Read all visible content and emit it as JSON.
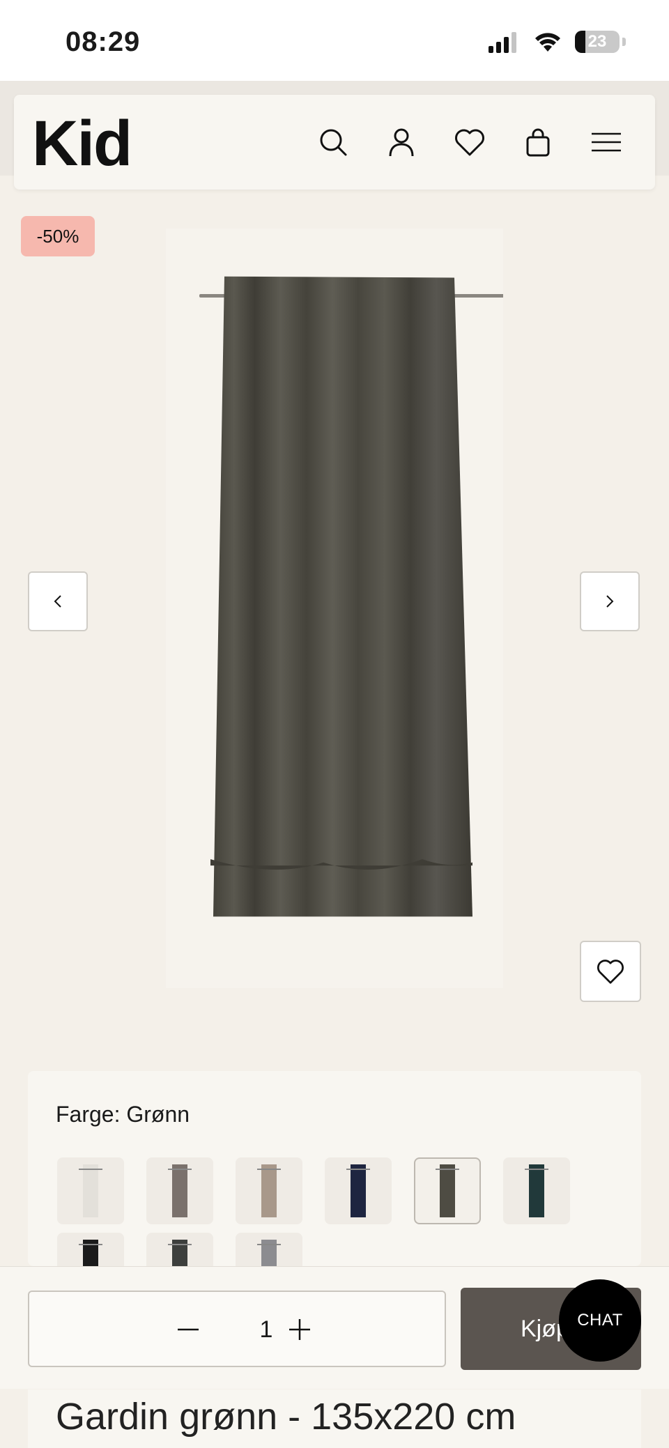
{
  "status_bar": {
    "time": "08:29",
    "battery": "23",
    "battery_level": 0.23
  },
  "header": {
    "logo": "Kid",
    "icons": [
      "search-icon",
      "user-icon",
      "heart-icon",
      "bag-icon",
      "menu-icon"
    ]
  },
  "product": {
    "discount_badge": "-50%",
    "image": {
      "subject": "curtain",
      "color": "#4e4c43"
    },
    "title": "Gardin grønn - 135x220 cm"
  },
  "gallery_nav": {
    "prev_icon": "chevron-left-icon",
    "next_icon": "chevron-right-icon",
    "favorite_icon": "heart-icon"
  },
  "color_selector": {
    "label": "Farge:",
    "value": "Grønn",
    "swatches": [
      {
        "color": "#e3e0da"
      },
      {
        "color": "#7a716c",
        "selected": false
      },
      {
        "color": "#a8988a"
      },
      {
        "color": "#1e2540"
      },
      {
        "color": "#4e4c43",
        "selected": true
      },
      {
        "color": "#21393a"
      },
      {
        "color": "#1b1b1b"
      },
      {
        "color": "#3d3f3d"
      },
      {
        "color": "#8c8c90"
      }
    ]
  },
  "purchase": {
    "quantity": "1",
    "buy_label": "Kjøp",
    "chat_label": "CHAT"
  },
  "colors": {
    "background": "#f4f0e9",
    "card": "#f8f6f1",
    "buy_button": "#5b5550",
    "badge": "#f6b8ae"
  }
}
